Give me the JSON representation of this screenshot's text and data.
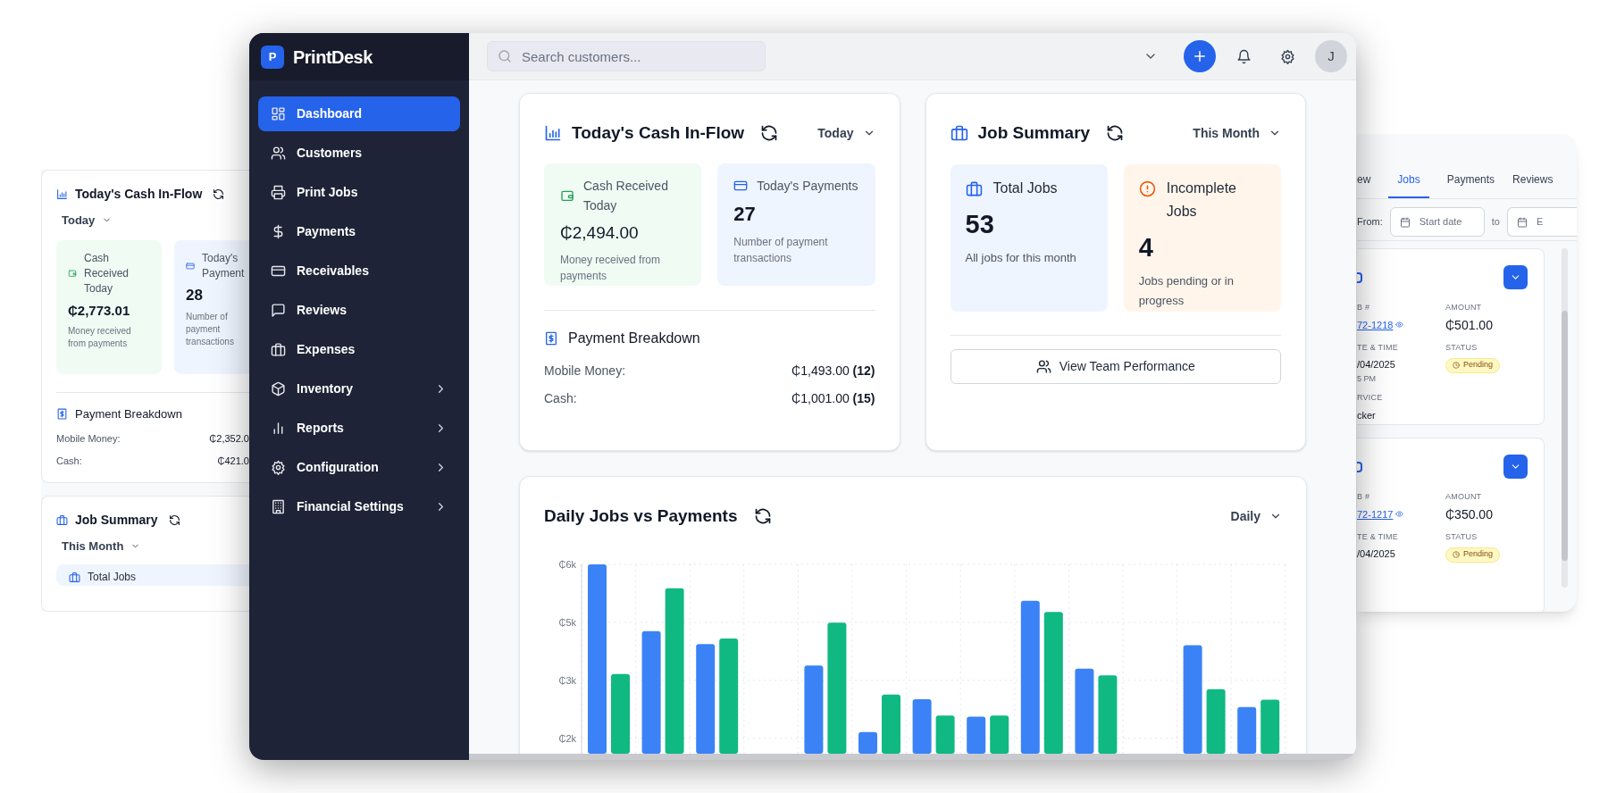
{
  "back_left_panel": {
    "cash_inflow": {
      "title": "Today's Cash In-Flow",
      "period": "Today",
      "cards": [
        {
          "kind": "cash",
          "label": "Cash Received Today",
          "value": "₵2,773.01",
          "note": "Money received from payments"
        },
        {
          "kind": "payments",
          "label": "Today's Payment",
          "value": "28",
          "note": "Number of payment transactions"
        }
      ],
      "breakdown": {
        "title": "Payment Breakdown",
        "rows": [
          {
            "label": "Mobile Money:",
            "amount": "₵2,352.0"
          },
          {
            "label": "Cash:",
            "amount": "₵421.0"
          }
        ]
      }
    },
    "job_summary": {
      "title": "Job Summary",
      "period": "This Month",
      "card_label": "Total Jobs"
    }
  },
  "sidebar": {
    "logo_letter": "P",
    "app_name": "PrintDesk",
    "items": [
      {
        "label": "Dashboard",
        "selected": true,
        "has_submenu": false
      },
      {
        "label": "Customers",
        "selected": false,
        "has_submenu": false
      },
      {
        "label": "Print Jobs",
        "selected": false,
        "has_submenu": false
      },
      {
        "label": "Payments",
        "selected": false,
        "has_submenu": false
      },
      {
        "label": "Receivables",
        "selected": false,
        "has_submenu": false
      },
      {
        "label": "Reviews",
        "selected": false,
        "has_submenu": false
      },
      {
        "label": "Expenses",
        "selected": false,
        "has_submenu": false
      },
      {
        "label": "Inventory",
        "selected": false,
        "has_submenu": true
      },
      {
        "label": "Reports",
        "selected": false,
        "has_submenu": true
      },
      {
        "label": "Configuration",
        "selected": false,
        "has_submenu": true
      },
      {
        "label": "Financial Settings",
        "selected": false,
        "has_submenu": true
      }
    ]
  },
  "topbar": {
    "search_placeholder": "Search customers...",
    "avatar_initial": "J"
  },
  "cash_inflow": {
    "title": "Today's Cash In-Flow",
    "period": "Today",
    "cards": [
      {
        "kind": "cash",
        "label": "Cash Received Today",
        "value": "₵2,494.00",
        "note": "Money received from payments"
      },
      {
        "kind": "payments",
        "label": "Today's Payments",
        "value": "27",
        "note": "Number of payment transactions"
      }
    ],
    "breakdown": {
      "title": "Payment Breakdown",
      "rows": [
        {
          "label": "Mobile Money:",
          "amount": "₵1,493.00 **(12)**"
        },
        {
          "label": "Cash:",
          "amount": "₵1,001.00 **(15)**"
        }
      ]
    }
  },
  "job_summary": {
    "title": "Job Summary",
    "period": "This Month",
    "cards": [
      {
        "kind": "total",
        "label": "Total Jobs",
        "value": "53",
        "note": "All jobs for this month"
      },
      {
        "kind": "incomplete",
        "label": "Incomplete Jobs",
        "value": "4",
        "note": "Jobs pending or in progress"
      }
    ],
    "button": "View Team Performance"
  },
  "chart_panel": {
    "title": "Daily Jobs vs Payments",
    "period": "Daily",
    "chart_data": {
      "type": "bar",
      "grid": true,
      "ylim": [
        1100,
        6000
      ],
      "yticks": [
        {
          "value": 1500,
          "label": "₵2k"
        },
        {
          "value": 3000,
          "label": "₵3k"
        },
        {
          "value": 4500,
          "label": "₵5k"
        },
        {
          "value": 6000,
          "label": "₵6k"
        }
      ],
      "series": [
        {
          "color": "#3b82f6",
          "values": [
            6000,
            4270,
            3940,
            null,
            3380,
            1660,
            2510,
            2060,
            5060,
            3300,
            null,
            3910,
            2310
          ]
        },
        {
          "color": "#10b981",
          "values": [
            3160,
            5380,
            4080,
            null,
            4490,
            2630,
            2090,
            2090,
            4770,
            3130,
            null,
            2770,
            2500
          ]
        }
      ]
    }
  },
  "back_right_panel": {
    "tabs": [
      {
        "label": "ew",
        "selected": false
      },
      {
        "label": "Jobs",
        "selected": true
      },
      {
        "label": "Payments",
        "selected": false
      },
      {
        "label": "Reviews",
        "selected": false
      }
    ],
    "filter": {
      "from_label": "From:",
      "start_placeholder": "Start date",
      "to_label": "to",
      "end_placeholder": "E"
    },
    "job_cards": [
      {
        "checked": false,
        "job_label": "B #",
        "job_number": "72-1218",
        "amount_label": "AMOUNT",
        "amount": "₵501.00",
        "datetime_label": "TE & TIME",
        "date": "/04/2025",
        "time": "5 PM",
        "status_label": "STATUS",
        "status": "Pending",
        "service_label": "RVICE",
        "service": "cker"
      },
      {
        "checked": false,
        "job_label": "B #",
        "job_number": "72-1217",
        "amount_label": "AMOUNT",
        "amount": "₵350.00",
        "datetime_label": "TE & TIME",
        "date": "/04/2025",
        "status_label": "STATUS",
        "status": "Pending"
      }
    ]
  }
}
